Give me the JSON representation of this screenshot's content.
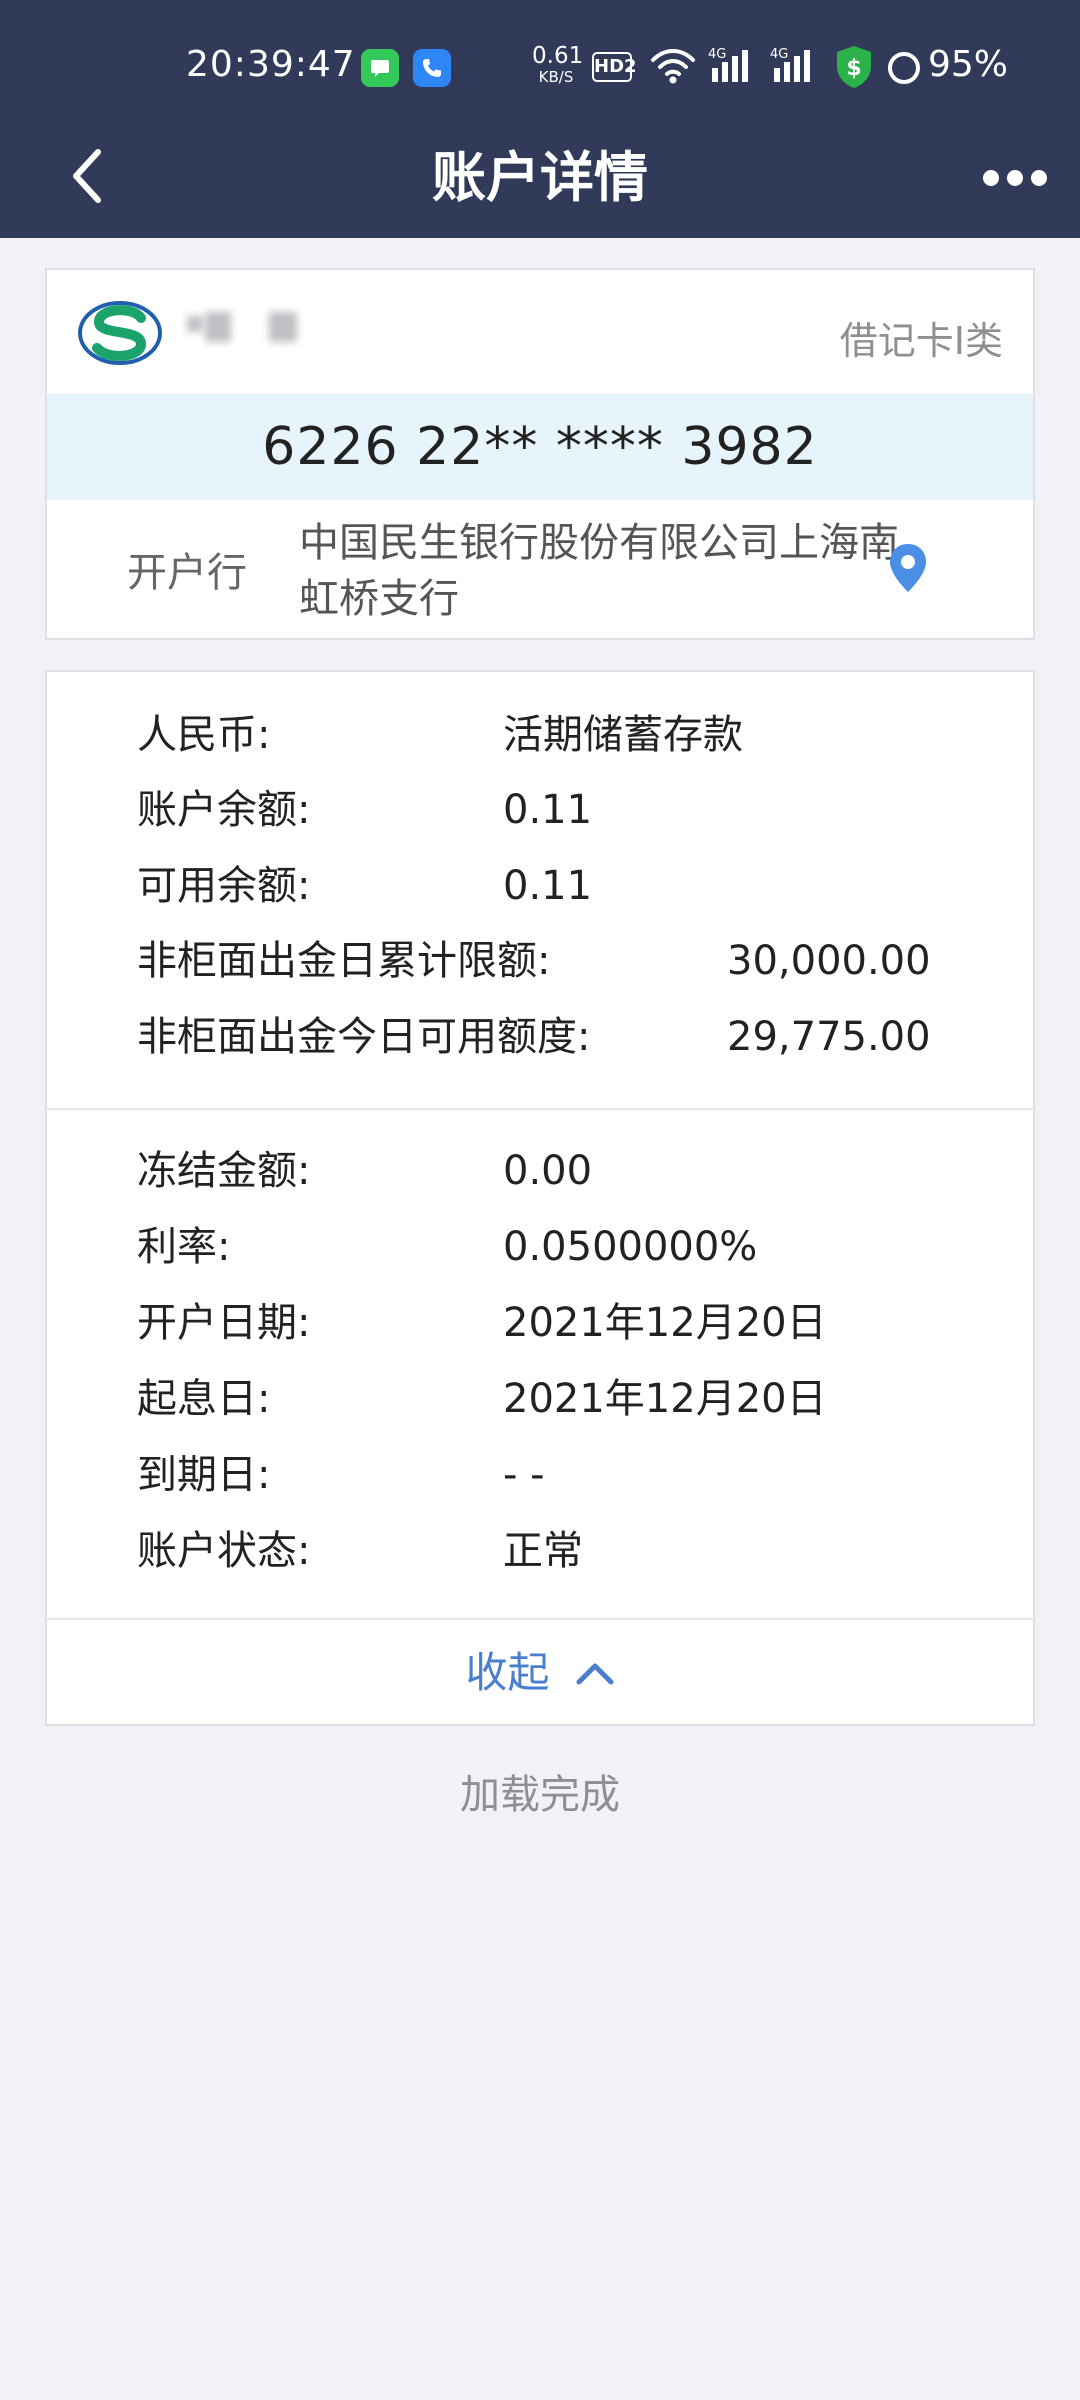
{
  "status_bar": {
    "time": "20:39:47",
    "net_speed_value": "0.61",
    "net_speed_unit": "KB/S",
    "hd_label": "HD2",
    "signal_1_label": "4G",
    "signal_2_label": "4G",
    "battery_percent": "95%",
    "icons": [
      "message-app-icon",
      "phone-app-icon",
      "wifi-icon",
      "signal-icon",
      "signal-icon",
      "shield-dollar-icon",
      "battery-ring-icon"
    ]
  },
  "nav": {
    "title": "账户详情",
    "back_icon": "chevron-left-icon",
    "more_icon": "more-dots-icon"
  },
  "account": {
    "card_type": "借记卡I类",
    "card_number": "6226 22** **** 3982",
    "branch_label": "开户行",
    "branch_value": "中国民生银行股份有限公司上海南虹桥支行"
  },
  "details_group1": [
    {
      "label": "人民币:",
      "value": "活期储蓄存款"
    },
    {
      "label": "账户余额:",
      "value": "0.11"
    },
    {
      "label": "可用余额:",
      "value": "0.11"
    },
    {
      "label": "非柜面出金日累计限额:",
      "value": "30,000.00"
    },
    {
      "label": "非柜面出金今日可用额度:",
      "value": "29,775.00"
    }
  ],
  "details_group2": [
    {
      "label": "冻结金额:",
      "value": "0.00"
    },
    {
      "label": "利率:",
      "value": "0.0500000%"
    },
    {
      "label": "开户日期:",
      "value": "2021年12月20日"
    },
    {
      "label": "起息日:",
      "value": "2021年12月20日"
    },
    {
      "label": "到期日:",
      "value": "- -"
    },
    {
      "label": "账户状态:",
      "value": "正常"
    }
  ],
  "collapse_label": "收起",
  "footer_text": "加载完成",
  "colors": {
    "header_bg": "#323a5a",
    "page_bg": "#f2f2f6",
    "card_number_bg": "#e7f4fc",
    "link_blue": "#4a7fd0",
    "logo_green": "#1aa36b",
    "logo_blue": "#1f5fae"
  }
}
